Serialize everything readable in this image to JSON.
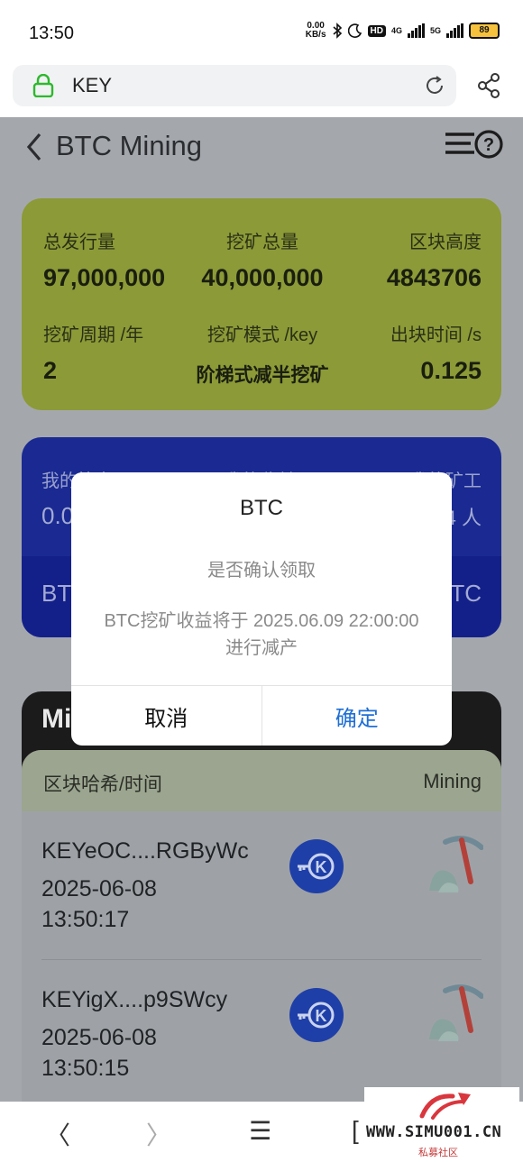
{
  "status_bar": {
    "time": "13:50",
    "net_speed_value": "0.00",
    "net_speed_unit": "KB/s",
    "hd_label": "HD",
    "net_4g": "4G",
    "net_5g": "5G",
    "battery": "89"
  },
  "browser": {
    "url": "KEY"
  },
  "header": {
    "title": "BTC Mining"
  },
  "stats_card": {
    "items": [
      {
        "label": "总发行量",
        "value": "97,000,000"
      },
      {
        "label": "挖矿总量",
        "value": "40,000,000"
      },
      {
        "label": "区块高度",
        "value": "4843706"
      },
      {
        "label": "挖矿周期 /年",
        "value": "2"
      },
      {
        "label": "挖矿模式 /key",
        "value": "阶梯式减半挖矿"
      },
      {
        "label": "出块时间 /s",
        "value": "0.125"
      }
    ]
  },
  "my_card": {
    "label_left": "我的算力",
    "label_mid": "我的收益",
    "label_right": "我的矿工",
    "value_left": "0.0",
    "value_right": "4 人",
    "strip_left": "BT",
    "strip_right": "TC"
  },
  "mining_panel": {
    "title": "Mi",
    "col_left": "区块哈希/时间",
    "col_right": "Mining",
    "rows": [
      {
        "hash": "KEYeOC....RGByWc",
        "date": "2025-06-08",
        "time": "13:50:17"
      },
      {
        "hash": "KEYigX....p9SWcy",
        "date": "2025-06-08",
        "time": "13:50:15"
      }
    ]
  },
  "modal": {
    "title": "BTC",
    "subtitle": "是否确认领取",
    "message": "BTC挖矿收益将于 2025.06.09 22:00:00 进行减产",
    "cancel": "取消",
    "confirm": "确定"
  },
  "bottom_nav": {
    "back": "〈",
    "forward": "〉",
    "menu": "☰",
    "tabs": "["
  },
  "watermark": {
    "text": "WWW.SIMU001.CN",
    "sub": "私募社区"
  },
  "colors": {
    "green_card": "#8c9a37",
    "blue_card": "#1a2a92",
    "confirm_blue": "#1f6fd6",
    "lock_green": "#2eb82e"
  }
}
